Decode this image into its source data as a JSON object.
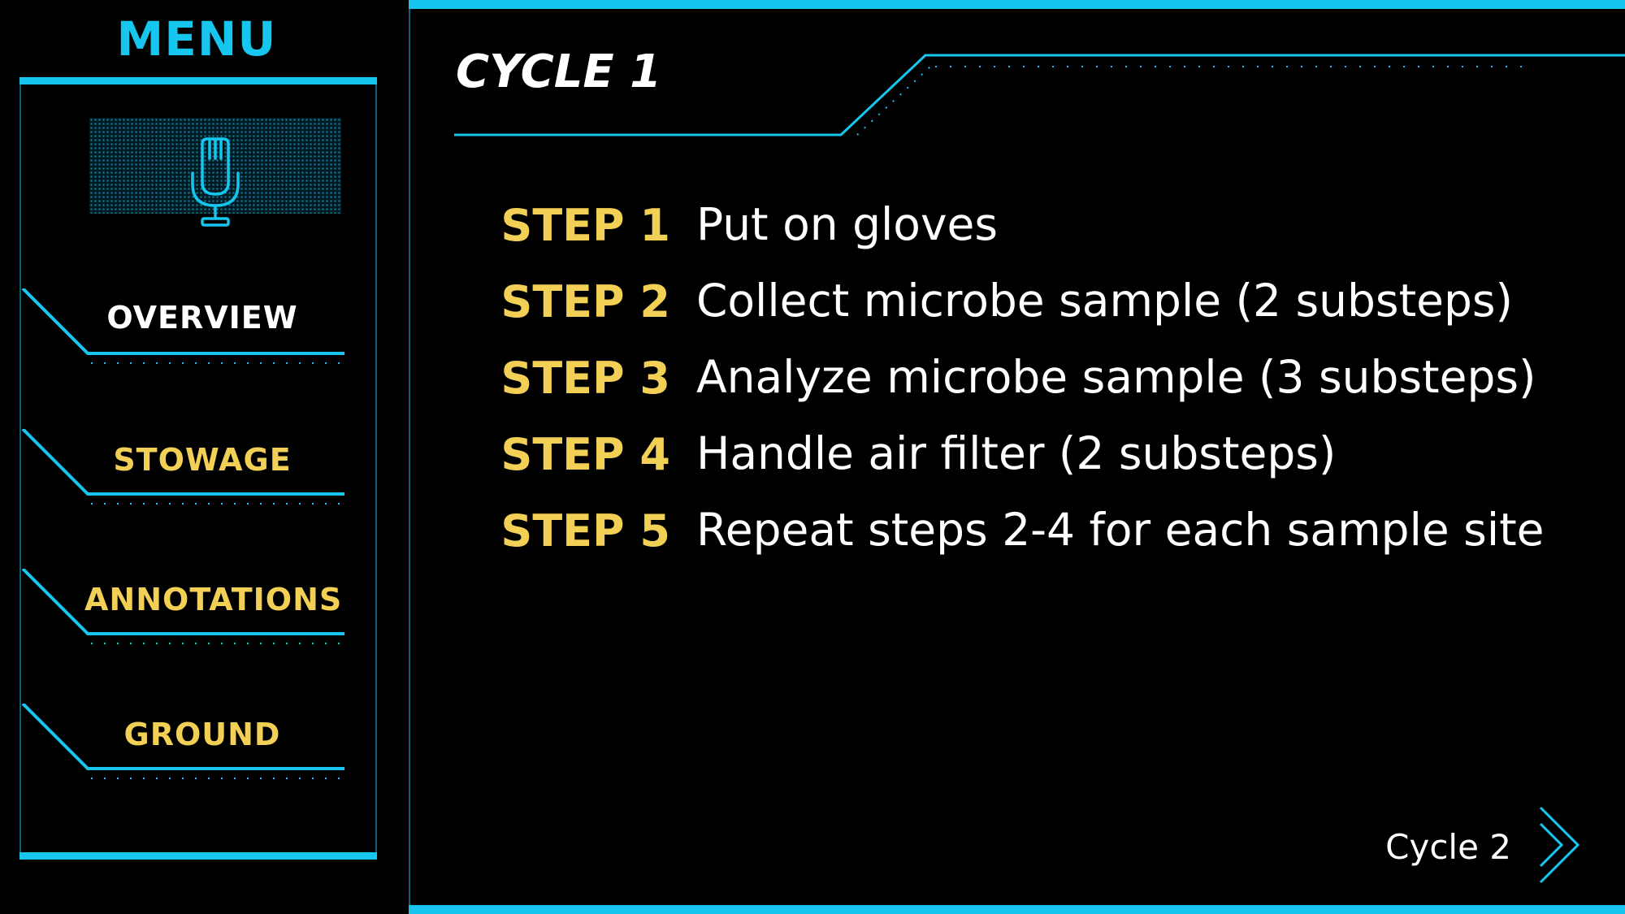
{
  "sidebar": {
    "title": "MENU",
    "mic_icon": "microphone-icon",
    "items": [
      {
        "label": "OVERVIEW",
        "color": "#ffffff"
      },
      {
        "label": "STOWAGE",
        "color": "#f2cf55"
      },
      {
        "label": "ANNOTATIONS",
        "color": "#f2cf55"
      },
      {
        "label": "GROUND",
        "color": "#f2cf55"
      }
    ]
  },
  "main": {
    "title": "CYCLE 1",
    "steps": [
      {
        "label": "STEP 1",
        "text": "Put on gloves"
      },
      {
        "label": "STEP 2",
        "text": "Collect microbe sample (2 substeps)"
      },
      {
        "label": "STEP 3",
        "text": "Analyze microbe sample (3 substeps)"
      },
      {
        "label": "STEP 4",
        "text": "Handle air filter (2 substeps)"
      },
      {
        "label": "STEP 5",
        "text": "Repeat steps 2-4 for each sample site"
      }
    ],
    "next": {
      "label": "Cycle 2",
      "icon": "double-chevron-right-icon"
    }
  },
  "colors": {
    "accent": "#16c6ee",
    "step_label": "#f2cf55",
    "background": "#000000"
  }
}
